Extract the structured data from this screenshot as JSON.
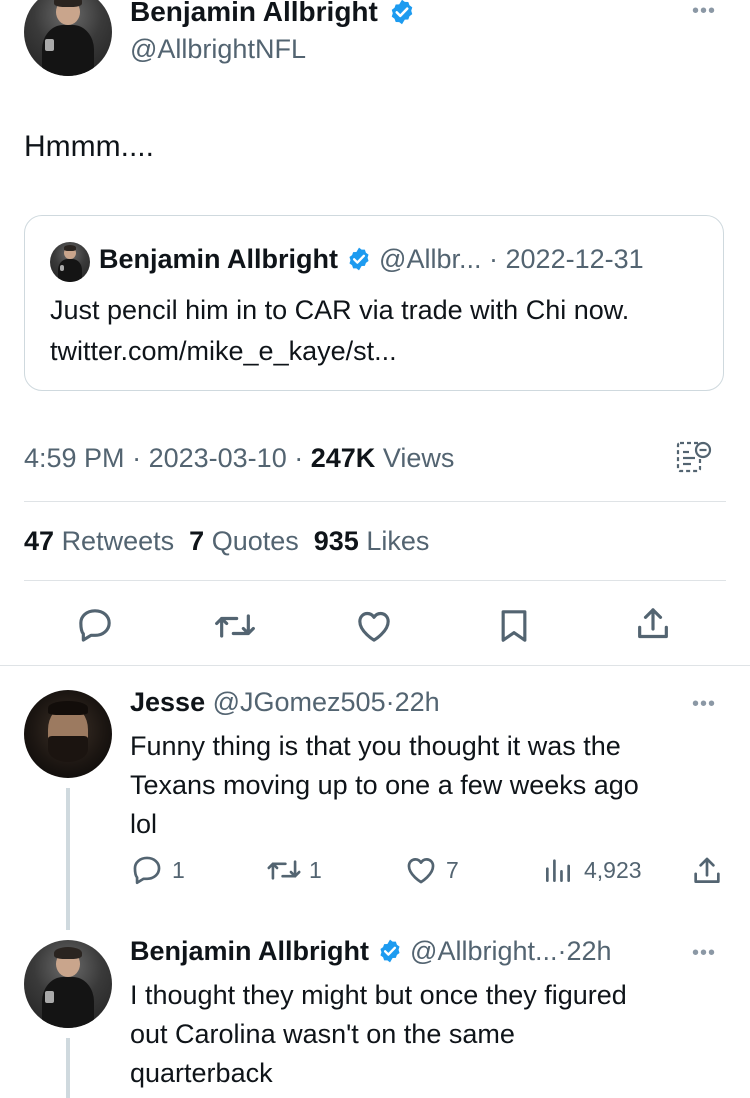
{
  "main_tweet": {
    "author_name": "Benjamin Allbright",
    "author_handle": "@AllbrightNFL",
    "text": "Hmmm....",
    "time": "4:59 PM",
    "date": "2023-03-10",
    "views_count": "247K",
    "views_label": "Views",
    "retweets_count": "47",
    "retweets_label": "Retweets",
    "quotes_count": "7",
    "quotes_label": "Quotes",
    "likes_count": "935",
    "likes_label": "Likes"
  },
  "quoted_tweet": {
    "author_name": "Benjamin Allbright",
    "author_handle": "@Allbr...",
    "date": "2022-12-31",
    "text_line1": "Just pencil him in to CAR via trade with Chi now.",
    "text_line2": "twitter.com/mike_e_kaye/st..."
  },
  "replies": [
    {
      "author_name": "Jesse",
      "author_handle": "@JGomez505",
      "time": "22h",
      "text_lines": [
        "Funny thing is that you thought it was the",
        "Texans moving up to one a few weeks ago",
        "lol"
      ],
      "reply_count": "1",
      "retweet_count": "1",
      "like_count": "7",
      "view_count": "4,923"
    },
    {
      "author_name": "Benjamin Allbright",
      "author_handle": "@Allbright...",
      "time": "22h",
      "text_lines": [
        "I thought they might but once they figured",
        "out Carolina wasn't on the same",
        "quarterback"
      ]
    }
  ],
  "separator": "·",
  "colors": {
    "verified": "#1d9bf0",
    "muted": "#536471",
    "divider": "#dfe3e6",
    "text": "#0f1419"
  },
  "icons": [
    "more-icon",
    "verified-badge-icon",
    "analytics-icon",
    "reply-icon",
    "retweet-icon",
    "like-icon",
    "bookmark-icon",
    "share-icon",
    "views-icon"
  ]
}
